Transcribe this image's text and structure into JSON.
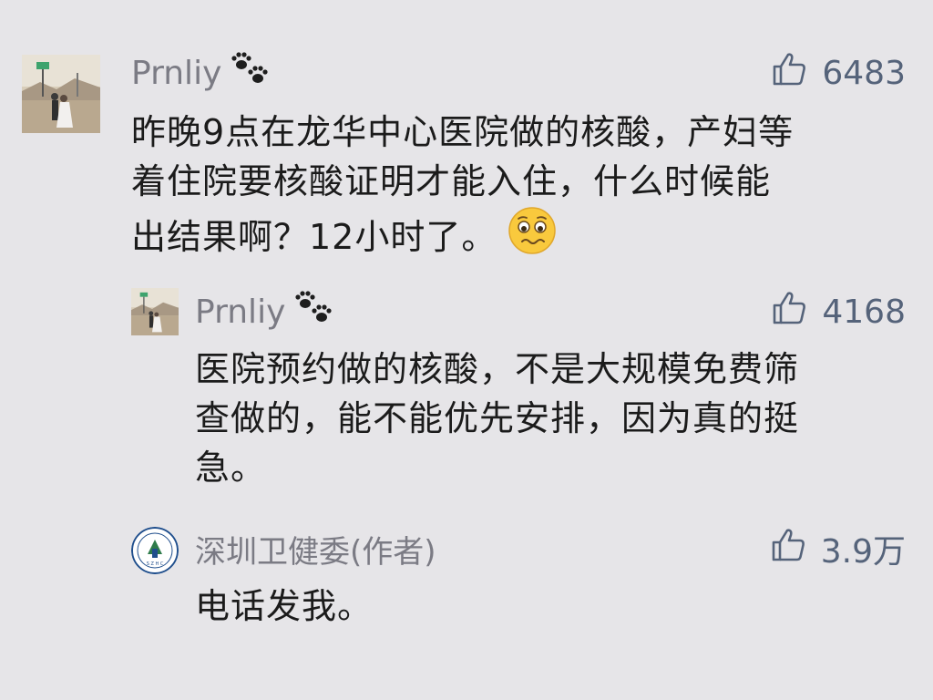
{
  "comments": [
    {
      "author": "Prnliy",
      "author_badge_icon": "paw-prints-icon",
      "likes": "6483",
      "text_lines": [
        "昨晚9点在龙华中心医院做的核酸，产妇等",
        "着住院要核酸证明才能入住，什么时候能",
        "出结果啊？12小时了。"
      ],
      "trailing_emoji": "worried-face-emoji"
    },
    {
      "author": "Prnliy",
      "author_badge_icon": "paw-prints-icon",
      "likes": "4168",
      "text_lines": [
        "医院预约做的核酸，不是大规模免费筛",
        "查做的，能不能优先安排，因为真的挺",
        "急。"
      ]
    },
    {
      "author": "深圳卫健委(作者)",
      "likes": "3.9万",
      "text_lines": [
        "电话发我。"
      ],
      "avatar_logo_text": "S Z H C"
    }
  ],
  "colors": {
    "background": "#e6e5e8",
    "author": "#7b7b84",
    "like": "#55637a",
    "text": "#1b1b1b"
  }
}
